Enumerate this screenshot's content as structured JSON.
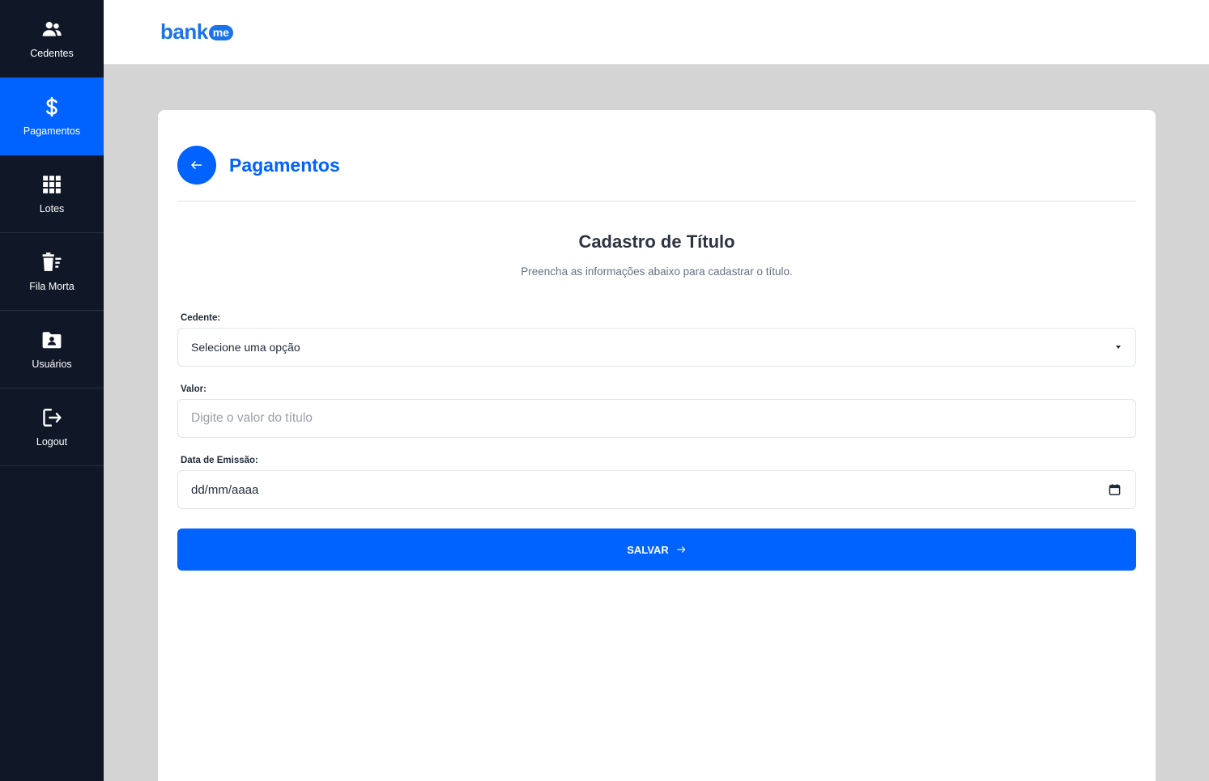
{
  "brand": {
    "word": "bank",
    "pill": "me",
    "color": "#1a73e8"
  },
  "colors": {
    "sidebar": "#101828",
    "accent": "#0062ff",
    "page_bg": "#d4d4d4"
  },
  "sidebar": {
    "items": [
      {
        "label": "Cedentes",
        "icon": "users-icon",
        "active": false
      },
      {
        "label": "Pagamentos",
        "icon": "dollar-icon",
        "active": true
      },
      {
        "label": "Lotes",
        "icon": "grid-icon",
        "active": false
      },
      {
        "label": "Fila Morta",
        "icon": "trash-list-icon",
        "active": false
      },
      {
        "label": "Usuários",
        "icon": "user-folder-icon",
        "active": false
      },
      {
        "label": "Logout",
        "icon": "logout-icon",
        "active": false
      }
    ]
  },
  "header": {
    "title": "Pagamentos",
    "back_icon": "arrow-left-icon"
  },
  "form": {
    "title": "Cadastro de Título",
    "subtitle": "Preencha as informações abaixo para cadastrar o título.",
    "cedente": {
      "label": "Cedente:",
      "value": "Selecione uma opção"
    },
    "valor": {
      "label": "Valor:",
      "placeholder": "Digite o valor do título"
    },
    "data_emissao": {
      "label": "Data de Emissão:",
      "value": "dd/mm/aaaa",
      "icon": "calendar-icon"
    },
    "submit_label": "SALVAR"
  }
}
